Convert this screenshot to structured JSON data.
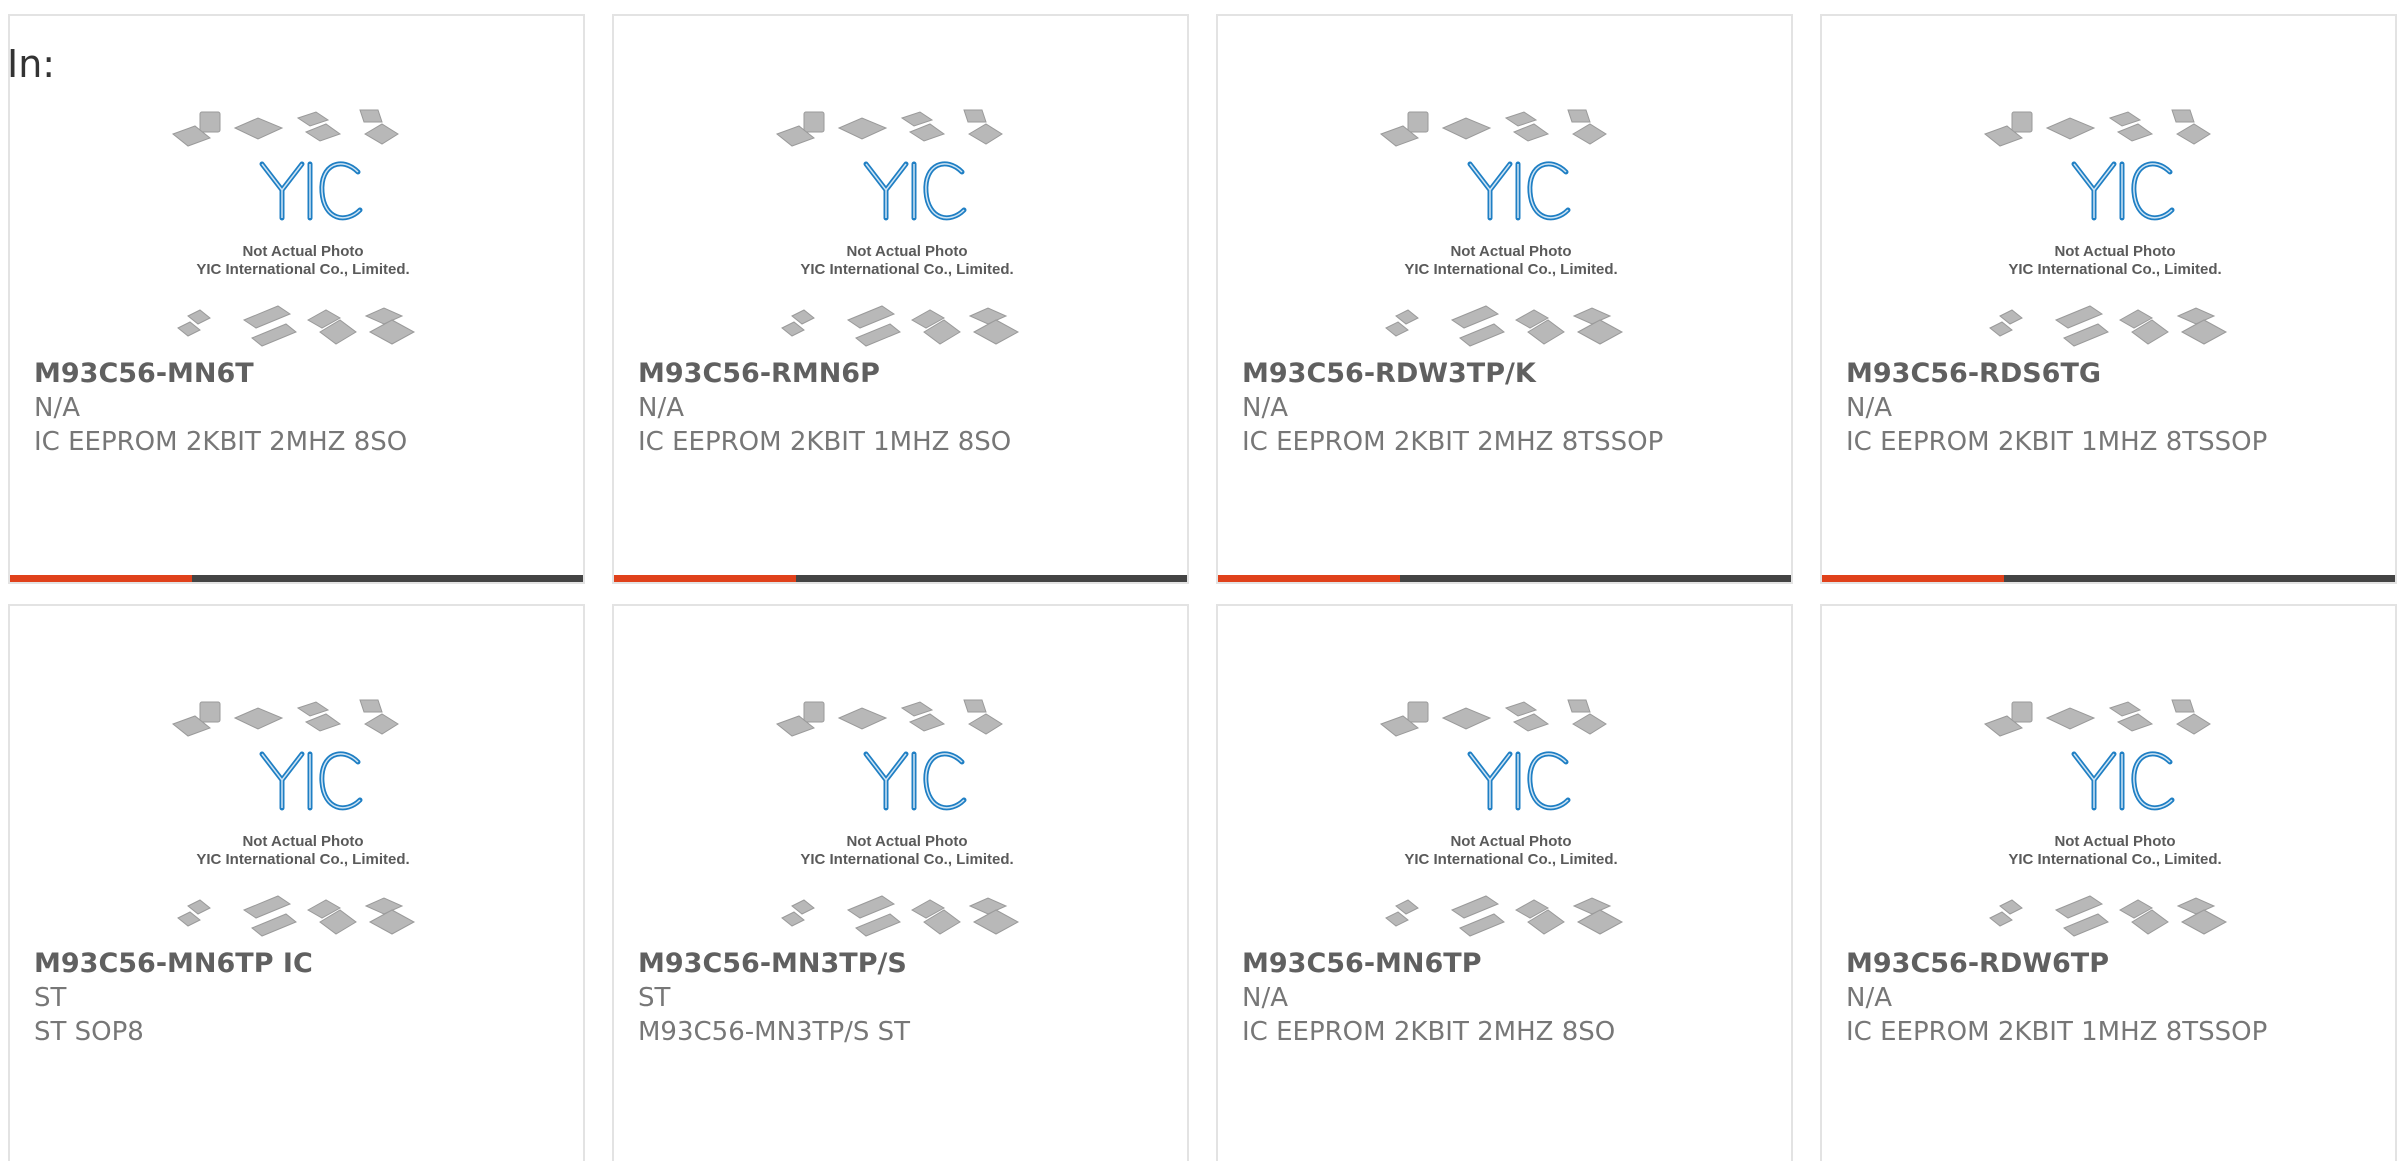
{
  "filter_label": "In:",
  "placeholder_image": {
    "caption_line1": "Not Actual Photo",
    "caption_line2": "YIC International Co., Limited.",
    "logo_text": "YIC",
    "colors": {
      "logo": "#1f7fc4",
      "chips": "#b8b8b8"
    }
  },
  "colors": {
    "accent": "#e0411b",
    "bar": "#444444",
    "border": "#e3e3e3"
  },
  "products": [
    {
      "part_number": "M93C56-MN6T",
      "manufacturer": "N/A",
      "description": "IC EEPROM 2KBIT 2MHZ 8SO"
    },
    {
      "part_number": "M93C56-RMN6P",
      "manufacturer": "N/A",
      "description": "IC EEPROM 2KBIT 1MHZ 8SO"
    },
    {
      "part_number": "M93C56-RDW3TP/K",
      "manufacturer": "N/A",
      "description": "IC EEPROM 2KBIT 2MHZ 8TSSOP"
    },
    {
      "part_number": "M93C56-RDS6TG",
      "manufacturer": "N/A",
      "description": "IC EEPROM 2KBIT 1MHZ 8TSSOP"
    },
    {
      "part_number": "M93C56-MN6TP IC",
      "manufacturer": "ST",
      "description": "ST SOP8"
    },
    {
      "part_number": "M93C56-MN3TP/S",
      "manufacturer": "ST",
      "description": "M93C56-MN3TP/S ST"
    },
    {
      "part_number": "M93C56-MN6TP",
      "manufacturer": "N/A",
      "description": "IC EEPROM 2KBIT 2MHZ 8SO"
    },
    {
      "part_number": "M93C56-RDW6TP",
      "manufacturer": "N/A",
      "description": "IC EEPROM 2KBIT 1MHZ 8TSSOP"
    }
  ]
}
